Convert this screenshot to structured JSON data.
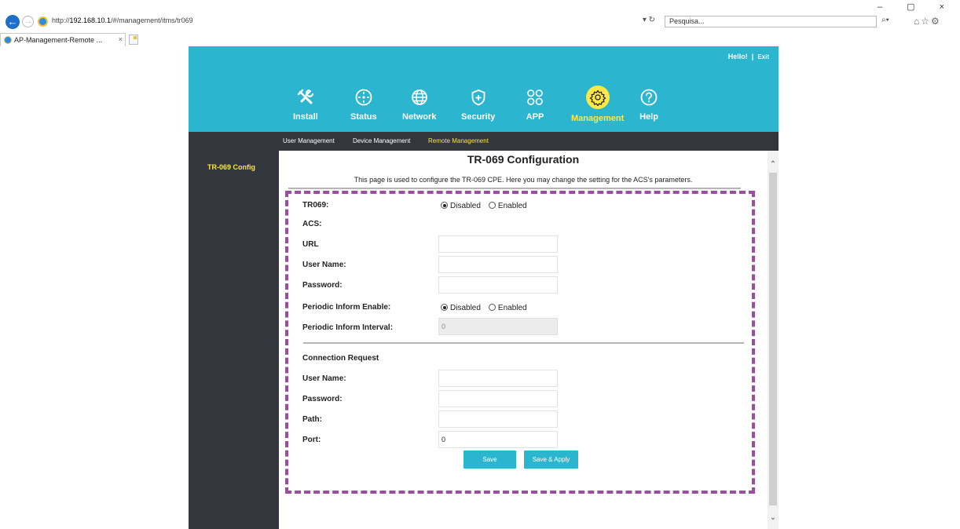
{
  "browser": {
    "url_prefix": "http://",
    "url_host": "192.168.10.1",
    "url_path": "/#/management/itms/tr069",
    "url_controls": "▾ ↻",
    "search_placeholder": "Pesquisa...",
    "tab_title": "AP-Management-Remote ...",
    "tab_close": "×",
    "window_controls": "–  ▢  ×"
  },
  "header": {
    "greeting": "Hello!",
    "separator": "|",
    "exit_label": "Exit",
    "nav": [
      {
        "label": "Install",
        "icon": "tools-icon"
      },
      {
        "label": "Status",
        "icon": "status-icon"
      },
      {
        "label": "Network",
        "icon": "globe-icon"
      },
      {
        "label": "Security",
        "icon": "shield-icon"
      },
      {
        "label": "APP",
        "icon": "apps-grid-icon"
      },
      {
        "label": "Management",
        "icon": "gear-icon",
        "active": true
      },
      {
        "label": "Help",
        "icon": "help-icon"
      }
    ],
    "active_color": "#fde846",
    "bg_color": "#2bb5cf"
  },
  "subnav": {
    "items": [
      "User Management",
      "Device Management",
      "Remote Management"
    ],
    "active_index": 2
  },
  "sidebar": {
    "items": [
      "TR-069 Config"
    ]
  },
  "main": {
    "title": "TR-069 Configuration",
    "description": "This page is used to configure the TR-069 CPE. Here you may change the setting for the ACS's parameters.",
    "tr069_label": "TR069:",
    "tr069_value": "Disabled",
    "acs_label": "ACS:",
    "url_label": "URL",
    "url_value": "",
    "username_label": "User Name:",
    "username_value": "",
    "password_label": "Password:",
    "password_value": "",
    "periodic_enable_label": "Periodic Inform Enable:",
    "periodic_enable_value": "Disabled",
    "periodic_interval_label": "Periodic Inform Interval:",
    "periodic_interval_value": "0",
    "connection_request_label": "Connection Request",
    "cr_username_label": "User Name:",
    "cr_username_value": "",
    "cr_password_label": "Password:",
    "cr_password_value": "",
    "cr_path_label": "Path:",
    "cr_path_value": "",
    "cr_port_label": "Port:",
    "cr_port_value": "0",
    "radio_disabled_label": "Disabled",
    "radio_enabled_label": "Enabled",
    "save_label": "Save",
    "save_apply_label": "Save & Apply",
    "highlight_color": "#9b4da0"
  }
}
